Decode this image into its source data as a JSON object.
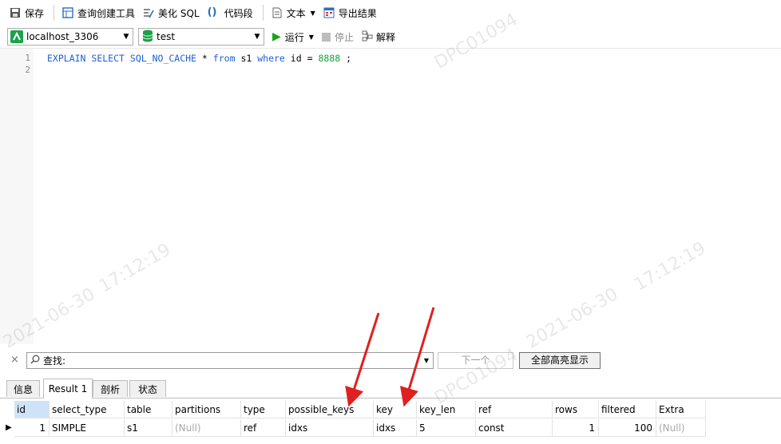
{
  "toolbar": {
    "save": "保存",
    "query_builder": "查询创建工具",
    "beautify_sql": "美化 SQL",
    "code_snippet": "代码段",
    "text": "文本",
    "export_results": "导出结果"
  },
  "connection": {
    "value": "localhost_3306"
  },
  "database": {
    "value": "test"
  },
  "run": {
    "run": "运行",
    "stop": "停止",
    "explain": "解释"
  },
  "editor": {
    "line_numbers": [
      "1",
      "2"
    ],
    "tokens": [
      "EXPLAIN",
      "SELECT",
      "SQL_NO_CACHE",
      "*",
      "from",
      "s1",
      "where",
      "id",
      "=",
      "8888",
      ";"
    ]
  },
  "find": {
    "placeholder": "查找:",
    "next": "下一个",
    "highlight_all": "全部高亮显示"
  },
  "tabs": [
    "信息",
    "Result 1",
    "剖析",
    "状态"
  ],
  "result": {
    "columns": [
      "id",
      "select_type",
      "table",
      "partitions",
      "type",
      "possible_keys",
      "key",
      "key_len",
      "ref",
      "rows",
      "filtered",
      "Extra"
    ],
    "row": [
      "1",
      "SIMPLE",
      "s1",
      "(Null)",
      "ref",
      "idxs",
      "idxs",
      "5",
      "const",
      "1",
      "100",
      "(Null)"
    ]
  },
  "watermarks": [
    "DPC01094",
    "2021-06-30",
    "17:12:19"
  ],
  "colors": {
    "keyword": "#1c5fd6",
    "number": "#1a9e3f",
    "arrow": "#e02020",
    "run_icon": "#1aa31a"
  }
}
